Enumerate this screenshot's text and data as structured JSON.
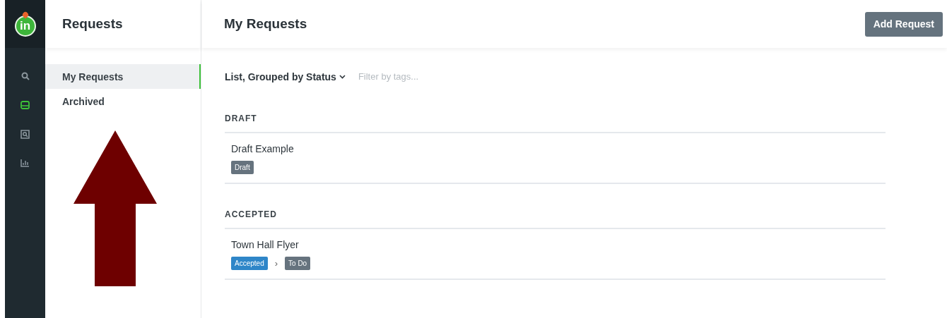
{
  "logo": {
    "text": "in"
  },
  "rail": [
    {
      "selected": false
    },
    {
      "selected": true
    },
    {
      "selected": false
    },
    {
      "selected": false
    }
  ],
  "sidebar": {
    "title": "Requests",
    "items": [
      {
        "label": "My Requests",
        "selected": true
      },
      {
        "label": "Archived",
        "selected": false
      }
    ]
  },
  "header": {
    "title": "My Requests",
    "button": "Add Request"
  },
  "toolbar": {
    "view": "List, Grouped by Status",
    "filter": {
      "placeholder": "Filter by tags..."
    }
  },
  "groups": [
    {
      "title": "DRAFT",
      "items": [
        {
          "name": "Draft Example",
          "tags": [
            {
              "label": "Draft",
              "color": "#66737e"
            }
          ]
        }
      ]
    },
    {
      "title": "ACCEPTED",
      "items": [
        {
          "name": "Town Hall Flyer",
          "separator": "›",
          "tags": [
            {
              "label": "Accepted",
              "color": "#2f86c8"
            },
            {
              "label": "To Do",
              "color": "#66737e"
            }
          ]
        }
      ]
    }
  ],
  "annotation": {
    "kind": "arrow"
  }
}
